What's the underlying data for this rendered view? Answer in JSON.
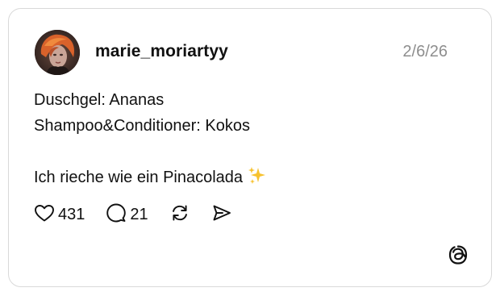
{
  "post": {
    "username": "marie_moriartyy",
    "date": "2/6/26",
    "lines": [
      "Duschgel: Ananas",
      "Shampoo&Conditioner: Kokos",
      "",
      "Ich rieche wie ein Pinacolada"
    ],
    "emoji": "sparkles"
  },
  "actions": {
    "likes": "431",
    "comments": "21",
    "icons": [
      "heart-icon",
      "comment-icon",
      "repost-icon",
      "share-icon"
    ]
  },
  "branding": {
    "logo": "threads-logo"
  },
  "colors": {
    "text": "#111111",
    "muted": "#8e8e8e",
    "border": "#d9d9d9",
    "sparkle": "#f7c22f"
  }
}
